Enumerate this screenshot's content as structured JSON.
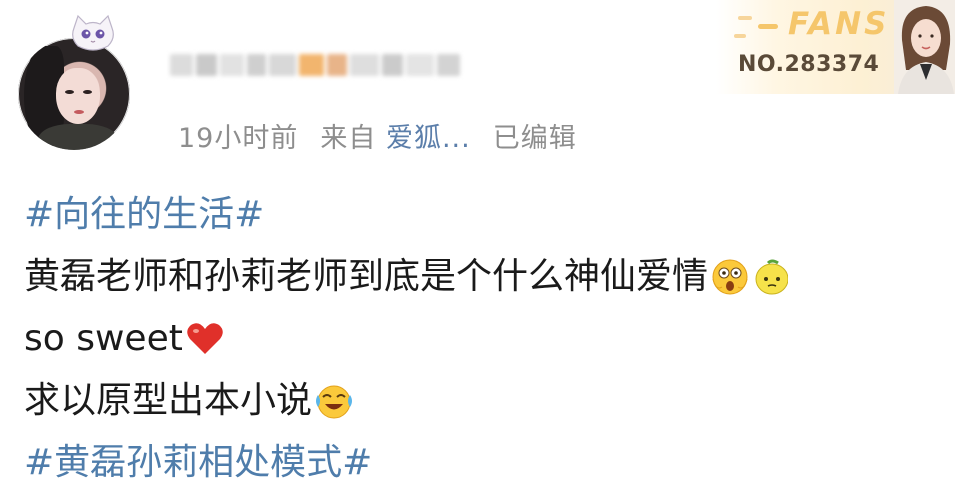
{
  "post": {
    "time": "19小时前",
    "from_label": "来自",
    "source": "爱狐...",
    "edited": "已编辑"
  },
  "badge": {
    "title": "FANS",
    "number": "NO.283374"
  },
  "content": {
    "hashtag_1": "#向往的生活#",
    "line_1": "黄磊老师和孙莉老师到底是个什么神仙爱情",
    "line_2": "so sweet",
    "line_3": "求以原型出本小说",
    "hashtag_2": "#黄磊孙莉相处模式#"
  },
  "icons": {
    "line_1_emojis": [
      "scared-face-icon",
      "lemon-face-icon"
    ],
    "line_2_emoji": "red-heart-icon",
    "line_3_emoji": "crying-laughing-icon"
  },
  "colors": {
    "hashtag": "#4f7dab",
    "meta": "#8e8e8e",
    "fans_gold": "#f5c66b"
  }
}
